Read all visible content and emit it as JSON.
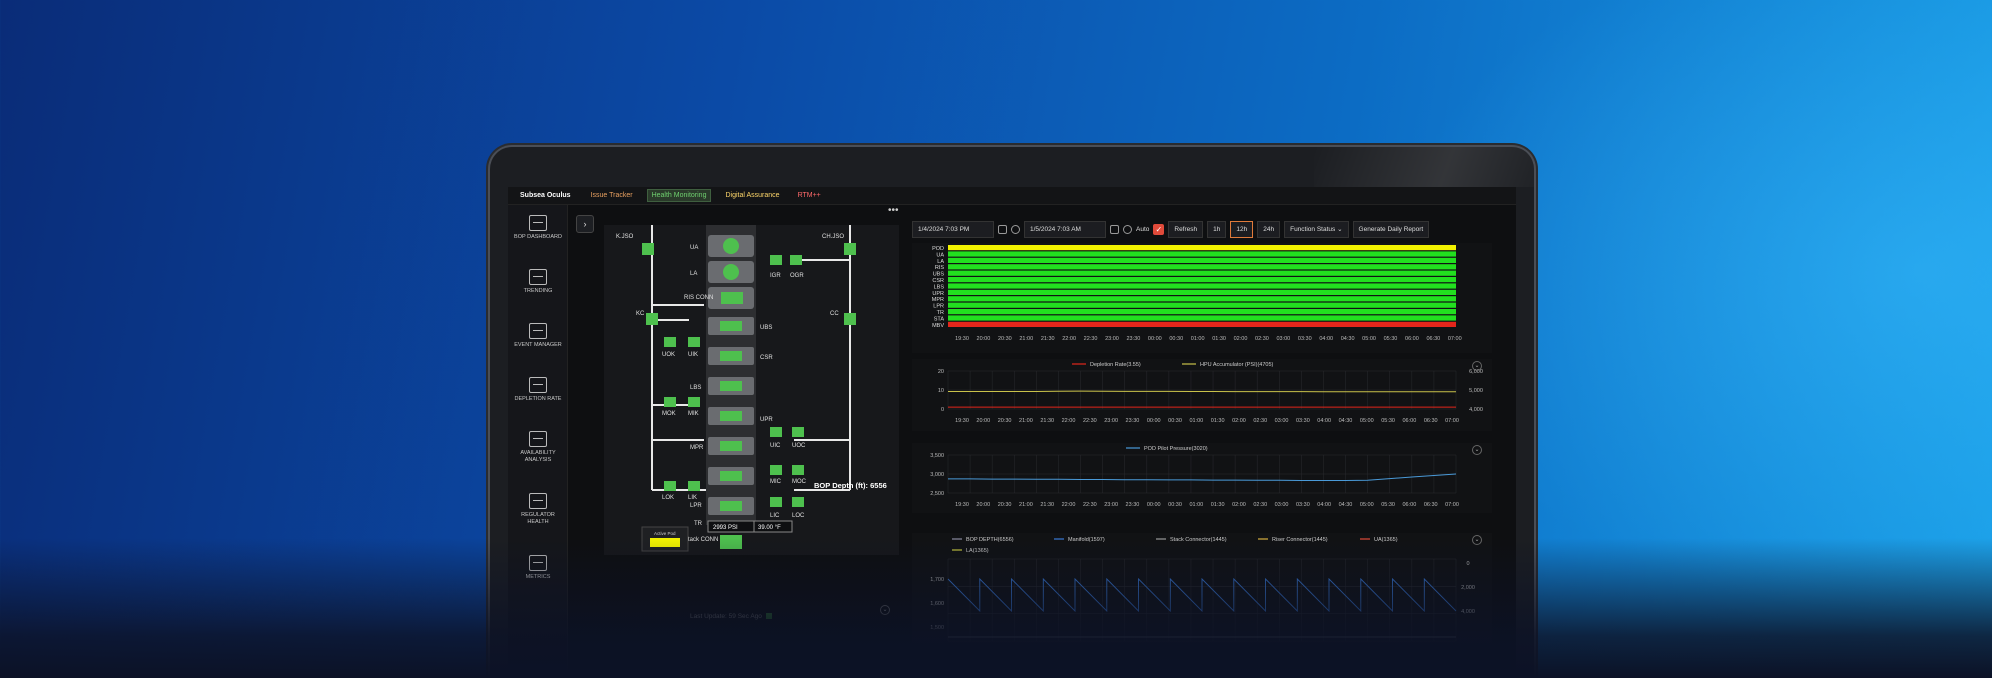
{
  "app": {
    "title": "Subsea Oculus",
    "tabs": [
      "Issue Tracker",
      "Health Monitoring",
      "Digital Assurance",
      "RTM++"
    ]
  },
  "sidebar": {
    "items": [
      {
        "label": "BOP DASHBOARD",
        "icon": "bop-dashboard-icon"
      },
      {
        "label": "TRENDING",
        "icon": "trending-icon"
      },
      {
        "label": "EVENT MANAGER",
        "icon": "event-manager-icon"
      },
      {
        "label": "DEPLETION RATE",
        "icon": "depletion-rate-icon"
      },
      {
        "label": "AVAILABILITY ANALYSIS",
        "icon": "availability-analysis-icon"
      },
      {
        "label": "REGULATOR HEALTH",
        "icon": "regulator-health-icon"
      },
      {
        "label": "METRICS",
        "icon": "metrics-icon"
      }
    ]
  },
  "diagram": {
    "labels": {
      "kjso": "K.JSO",
      "chjso": "CH.JSO",
      "ua": "UA",
      "la": "LA",
      "ris_conn": "RIS CONN",
      "igr": "IGR",
      "ogr": "OGR",
      "kc": "KC",
      "cc": "CC",
      "ubs": "UBS",
      "uok": "UOK",
      "uik": "UIK",
      "csr": "CSR",
      "lbs": "LBS",
      "mok": "MOK",
      "mik": "MIK",
      "upr": "UPR",
      "uic": "UIC",
      "uoc": "UOC",
      "mpr": "MPR",
      "mic": "MIC",
      "moc": "MOC",
      "lok": "LOK",
      "lik": "LIK",
      "lpr": "LPR",
      "lic": "LIC",
      "loc": "LOC",
      "tr": "TR",
      "stack_conn": "Stack CONN"
    },
    "pressure": "2993 PSI",
    "temperature": "39.00 °F",
    "active_pod_label": "Active Pod",
    "bop_depth": "BOP Depth (ft): 6556",
    "last_update": "Last Update: 59 Sec Ago"
  },
  "toolbar": {
    "start_date": "1/4/2024 7:03 PM",
    "end_date": "1/5/2024 7:03 AM",
    "auto_label": "Auto",
    "refresh_label": "Refresh",
    "ranges": [
      "1h",
      "12h",
      "24h"
    ],
    "active_range": "12h",
    "function_select": "Function Status",
    "report_button": "Generate Daily Report"
  },
  "colors": {
    "status_green": "#22e01f",
    "pod_yellow": "#f2f200",
    "mbv_red": "#e3261b",
    "depletion_red": "#e3261b",
    "hpu_yellow": "#c9c24a",
    "pod_pilot_blue": "#4a9ad8",
    "diagram_green": "#4ec04e"
  },
  "chart_data": [
    {
      "type": "heatmap",
      "rows": [
        "POD",
        "UA",
        "LA",
        "RIS",
        "UBS",
        "CSR",
        "LBS",
        "UPR",
        "MPR",
        "LPR",
        "TR",
        "STA",
        "MBV"
      ],
      "x": [
        "19:30",
        "20:00",
        "20:30",
        "21:00",
        "21:30",
        "22:00",
        "22:30",
        "23:00",
        "23:30",
        "00:00",
        "00:30",
        "01:00",
        "01:30",
        "02:00",
        "02:30",
        "03:00",
        "03:30",
        "04:00",
        "04:30",
        "05:00",
        "05:30",
        "06:00",
        "06:30",
        "07:00"
      ],
      "row_status": [
        "yellow",
        "green",
        "green",
        "green",
        "green",
        "green",
        "green",
        "green",
        "green",
        "green",
        "green",
        "green",
        "red"
      ]
    },
    {
      "type": "line",
      "series": [
        {
          "name": "Depletion Rate(3.55)",
          "axis": "left",
          "values": [
            1,
            1,
            1,
            1,
            1,
            1,
            1,
            1,
            1,
            1,
            1,
            1,
            1,
            1,
            1,
            1,
            1,
            1,
            1,
            1,
            1,
            1,
            1,
            1
          ]
        },
        {
          "name": "HPU Accumulator (PSI)(4705)",
          "axis": "right",
          "values": [
            4920,
            4920,
            4920,
            4920,
            4920,
            4930,
            4940,
            4930,
            4928,
            4926,
            4924,
            4922,
            4920,
            4918,
            4916,
            4915,
            4914,
            4913,
            4912,
            4911,
            4910,
            4909,
            4908,
            4907
          ]
        }
      ],
      "x": [
        "19:30",
        "20:00",
        "20:30",
        "21:00",
        "21:30",
        "22:00",
        "22:30",
        "23:00",
        "23:30",
        "00:00",
        "00:30",
        "01:00",
        "01:30",
        "02:00",
        "02:30",
        "03:00",
        "03:30",
        "04:00",
        "04:30",
        "05:00",
        "05:30",
        "06:00",
        "06:30",
        "07:00"
      ],
      "yticks_left": [
        0,
        10,
        20
      ],
      "yticks_right": [
        "4,000",
        "5,000",
        "6,000"
      ],
      "ylim_left": [
        0,
        20
      ],
      "ylim_right": [
        4000,
        6000
      ]
    },
    {
      "type": "line",
      "series": [
        {
          "name": "POD Pilot Pressure(3020)",
          "values": [
            2870,
            2870,
            2865,
            2865,
            2860,
            2860,
            2855,
            2855,
            2850,
            2850,
            2845,
            2845,
            2840,
            2840,
            2835,
            2835,
            2830,
            2830,
            2830,
            2835,
            2880,
            2920,
            2960,
            3000
          ]
        }
      ],
      "x": [
        "19:30",
        "20:00",
        "20:30",
        "21:00",
        "21:30",
        "22:00",
        "22:30",
        "23:00",
        "23:30",
        "00:00",
        "00:30",
        "01:00",
        "01:30",
        "02:00",
        "02:30",
        "03:00",
        "03:30",
        "04:00",
        "04:30",
        "05:00",
        "05:30",
        "06:00",
        "06:30",
        "07:00"
      ],
      "yticks": [
        "2,500",
        "3,000",
        "3,500"
      ],
      "ylim": [
        2500,
        3500
      ]
    },
    {
      "type": "line",
      "legend": [
        "BOP DEPTH(6556)",
        "Manifold(1597)",
        "Stack Connector(1445)",
        "Riser Connector(1445)",
        "UA(1365)",
        "LA(1365)"
      ],
      "legend_colors": [
        "#8a8aa0",
        "#3a7ad8",
        "#9a9a9a",
        "#d8b040",
        "#e04a3a",
        "#c8c840"
      ],
      "yticks_left": [
        "1,500",
        "1,600",
        "1,700"
      ],
      "yticks_right": [
        "0",
        "2,000",
        "4,000"
      ],
      "ylim_left": [
        1440,
        1700
      ],
      "ylim_right": [
        0,
        6000
      ]
    }
  ]
}
